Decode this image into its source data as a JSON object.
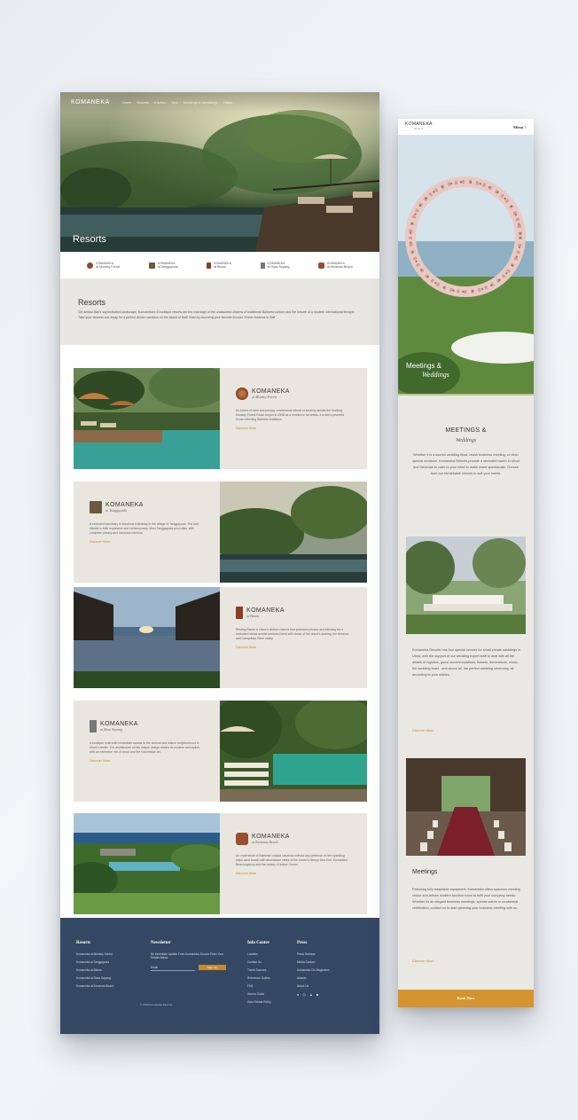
{
  "desktop": {
    "nav": {
      "logo": "KOMANEKA",
      "items": [
        "Home",
        "Resorts",
        "Kitchen",
        "Spa",
        "Meetings & Weddings",
        "Offers"
      ]
    },
    "hero_title": "Resorts",
    "logos": [
      {
        "name": "KOMANEKA",
        "sub": "at Monkey Forest"
      },
      {
        "name": "KOMANEKA",
        "sub": "at Tanggayuda"
      },
      {
        "name": "KOMANEKA",
        "sub": "at Bisma"
      },
      {
        "name": "KOMANEKA",
        "sub": "at Rasa Sayang"
      },
      {
        "name": "KOMANEKA",
        "sub": "at Keramas Beach"
      }
    ],
    "intro": {
      "title": "Resorts",
      "text": "Set amidst Bali's sophisticated landscape, Komaneka's 5 boutique resorts are the marriage of the unassorted charms of traditional Balinese culture and the leisure of a modern international lifestyle. Take your dearest one away for a perfect dream vacation on the island of Bali! Start by choosing your favorite Annual \"Home Address in Bali\""
    },
    "resorts": [
      {
        "name": "KOMANEKA",
        "sub": "at Monkey Forest",
        "desc": "As lovers of calm and privacy, a whimsical retreat of serenity amidst the bustling Monkey Forest Road, begun in 1998 as a residence for artists, it is still a peaceful home reflecting Balinese traditions.",
        "cta": "Discover More"
      },
      {
        "name": "KOMANEKA",
        "sub": "at Tanggayuda",
        "desc": "A secluded sanctuary in luxurious hideaway in the village of Tanggayuda. The lush hillside is both expansive and contemporary. Most Tanggayuda pool villas, with complete privacy and luxurious interiors.",
        "cta": "Discover More"
      },
      {
        "name": "KOMANEKA",
        "sub": "at Bisma",
        "desc": "Resting Bisma is Ubud's distinct charms that promises privacy and intimacy for a secluded retreat amidst terraces forest with views of the resort's soaring rice terraces and Campuhan River valley.",
        "cta": "Discover More"
      },
      {
        "name": "KOMANEKA",
        "sub": "at Rasa Sayang",
        "desc": "A boutique hotel with immediate access to the cultural and leisure neighborhood in Ubud's center. The architecture of this unique design retains its modern and stylish, with an extensive mix of wood and the Indonesian art.",
        "cta": "Discover More"
      },
      {
        "name": "KOMANEKA",
        "sub": "at Keramas Beach",
        "desc": "An experience of Balinese coastal luxurious without any pretense on the sparkling black sand beach with abundance views of the ocean's Sleepy Sea Surf. Komaneka Beach agency and the beauty of Indian Ocean.",
        "cta": "Discover More"
      }
    ],
    "footer": {
      "resorts": {
        "title": "Resorts",
        "items": [
          "Komaneka at Monkey Forest",
          "Komaneka at Tanggayuda",
          "Komaneka at Bisma",
          "Komaneka at Rasa Sayang",
          "Komaneka at Keramas Beach"
        ]
      },
      "newsletter": {
        "title": "Newsletter",
        "text": "Be Inmediate Update From Komaneka, Ensure Enter Your Details Below",
        "placeholder": "Email",
        "button": "Sign Up"
      },
      "info": {
        "title": "Info Centre",
        "items": [
          "Location",
          "Contact Us",
          "Travel Sources",
          "Reference Guides",
          "FAQ",
          "How to Clubs",
          "Halo Private Policy"
        ]
      },
      "press": {
        "title": "Press",
        "items": [
          "Press Release",
          "Media Contact",
          "Komaneka On Magazines",
          "Awards",
          "About Us"
        ]
      },
      "copyright": "© 2018 Komaneka Resorts"
    }
  },
  "mobile": {
    "logo": "KOMANEKA",
    "logo_sub": "Resorts",
    "menu": "Menu ≡",
    "hero_title": "Meetings &",
    "hero_title_italic": "Weddings",
    "section_title": "MEETINGS &",
    "section_title_italic": "Weddings",
    "section_text": "Whether it is a sacred wedding ritual, lavish business meeting, or other special occasion, Komaneka Resorts provide a secluded haven in Ubud and Keramas to cater to your need to make event spectacular. Choose from our remarkable venues to suit your needs.",
    "weddings_text": "Komaneka Resorts has four special venues for small private weddings in Ubud, with the support of our wedding expert staff to deal with all the details of logistics, guest accommodations, flowers, decorations, music, the wedding feast - and above all, the perfect wedding ceremony, all according to your wishes.",
    "weddings_cta": "Discover More",
    "meetings_title": "Meetings",
    "meetings_text": "Featuring fully adaptable equipment, Komaneka offers spacious meeting venue and artistic modern function room to fulfil your company needs. Whether its an elegant business meetings, special soiree or occasional celebration, contact us to start planning your business meeting with us.",
    "meetings_cta": "Discover More",
    "book_now": "Book Now"
  }
}
